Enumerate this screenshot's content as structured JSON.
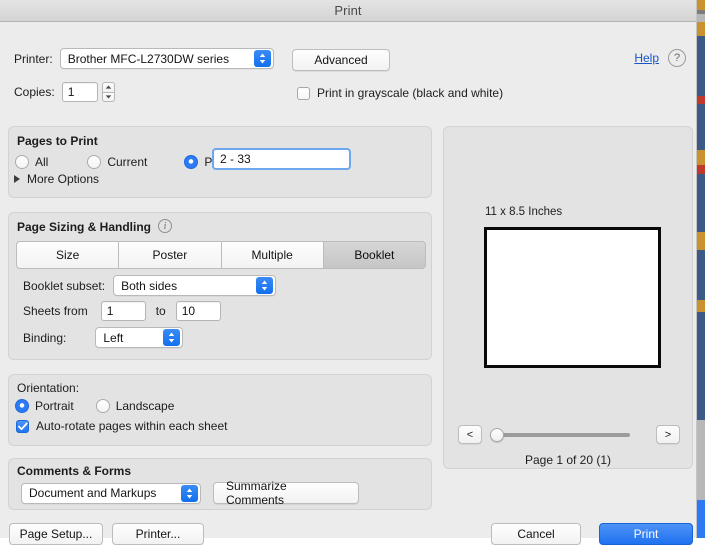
{
  "window": {
    "title": "Print"
  },
  "top": {
    "printer_label": "Printer:",
    "printer_value": "Brother MFC-L2730DW series",
    "advanced_label": "Advanced",
    "help_label": "Help",
    "help_icon_glyph": "?",
    "copies_label": "Copies:",
    "copies_value": "1",
    "grayscale_label": "Print in grayscale (black and white)",
    "grayscale_checked": false
  },
  "pages_to_print": {
    "title": "Pages to Print",
    "options": [
      {
        "label": "All",
        "selected": false
      },
      {
        "label": "Current",
        "selected": false
      },
      {
        "label": "Pages",
        "selected": true
      }
    ],
    "pages_value": "2 - 33",
    "more_options_label": "More Options"
  },
  "page_sizing": {
    "title": "Page Sizing & Handling",
    "info_glyph": "i",
    "segments": [
      {
        "label": "Size",
        "active": false
      },
      {
        "label": "Poster",
        "active": false
      },
      {
        "label": "Multiple",
        "active": false
      },
      {
        "label": "Booklet",
        "active": true
      }
    ],
    "booklet_subset_label": "Booklet subset:",
    "booklet_subset_value": "Both sides",
    "sheets_from_label": "Sheets from",
    "sheets_from_value": "1",
    "sheets_to_label": "to",
    "sheets_to_value": "10",
    "binding_label": "Binding:",
    "binding_value": "Left"
  },
  "orientation": {
    "title": "Orientation:",
    "options": [
      {
        "label": "Portrait",
        "selected": true
      },
      {
        "label": "Landscape",
        "selected": false
      }
    ],
    "autorotate_label": "Auto-rotate pages within each sheet",
    "autorotate_checked": true
  },
  "comments_forms": {
    "title": "Comments & Forms",
    "selected": "Document and Markups",
    "summarize_label": "Summarize Comments"
  },
  "preview": {
    "paper_size_label": "11 x 8.5 Inches",
    "prev_label": "<",
    "next_label": ">",
    "page_count_label": "Page 1 of 20 (1)"
  },
  "footer": {
    "page_setup_label": "Page Setup...",
    "printer_label": "Printer...",
    "cancel_label": "Cancel",
    "print_label": "Print"
  },
  "colors": {
    "accent_blue": "#1f72ef",
    "link_blue": "#1a55c8",
    "window_bg": "#ececec",
    "group_bg": "#e3e3e3"
  }
}
